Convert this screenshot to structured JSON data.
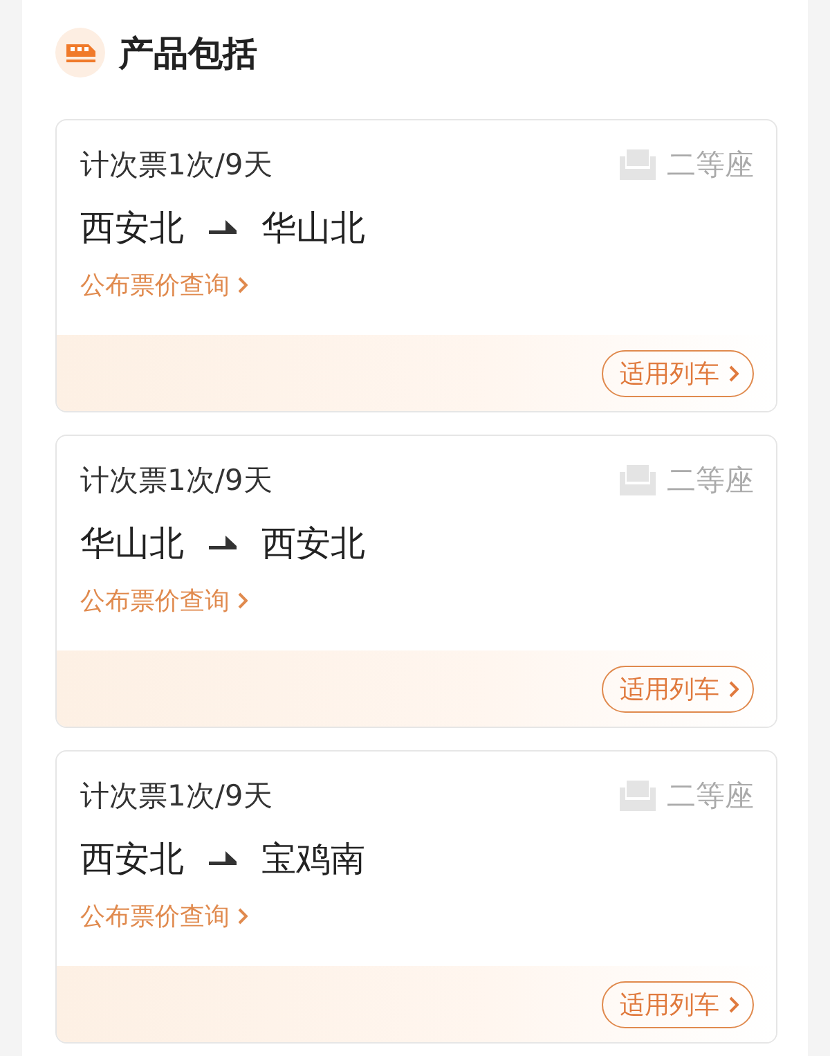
{
  "section": {
    "title": "产品包括"
  },
  "tickets": [
    {
      "type": "计次票1次/9天",
      "seat": "二等座",
      "from": "西安北",
      "to": "华山北",
      "link": "公布票价查询",
      "button": "适用列车"
    },
    {
      "type": "计次票1次/9天",
      "seat": "二等座",
      "from": "华山北",
      "to": "西安北",
      "link": "公布票价查询",
      "button": "适用列车"
    },
    {
      "type": "计次票1次/9天",
      "seat": "二等座",
      "from": "西安北",
      "to": "宝鸡南",
      "link": "公布票价查询",
      "button": "适用列车"
    }
  ]
}
